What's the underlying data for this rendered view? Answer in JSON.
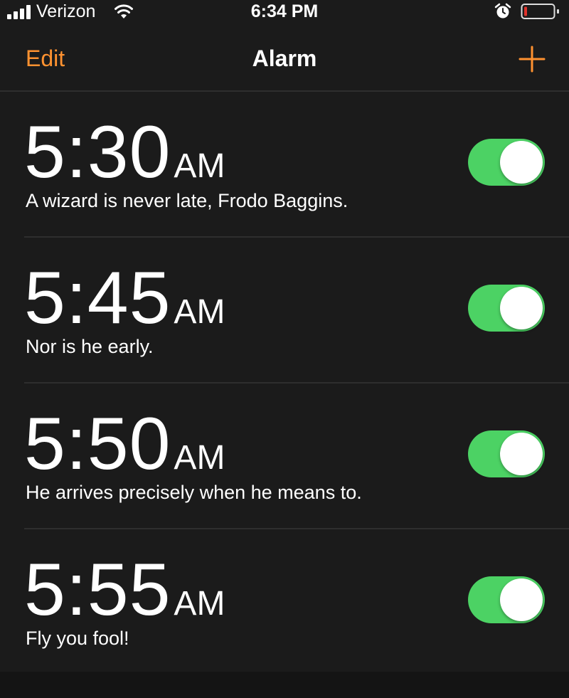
{
  "status_bar": {
    "carrier": "Verizon",
    "time": "6:34 PM",
    "icons": [
      "signal-icon",
      "wifi-icon",
      "alarm-clock-icon",
      "battery-icon"
    ]
  },
  "nav": {
    "edit_label": "Edit",
    "title": "Alarm",
    "add_icon": "plus-icon"
  },
  "colors": {
    "accent": "#ff9230",
    "toggle_on": "#4cd264",
    "background": "#1b1b1b",
    "battery_low": "#e0322b"
  },
  "alarms": [
    {
      "time": "5:30",
      "ampm": "AM",
      "label": "A wizard is never late, Frodo Baggins.",
      "enabled": true
    },
    {
      "time": "5:45",
      "ampm": "AM",
      "label": "Nor is he early.",
      "enabled": true
    },
    {
      "time": "5:50",
      "ampm": "AM",
      "label": "He arrives precisely when he means to.",
      "enabled": true
    },
    {
      "time": "5:55",
      "ampm": "AM",
      "label": "Fly you fool!",
      "enabled": true
    }
  ]
}
